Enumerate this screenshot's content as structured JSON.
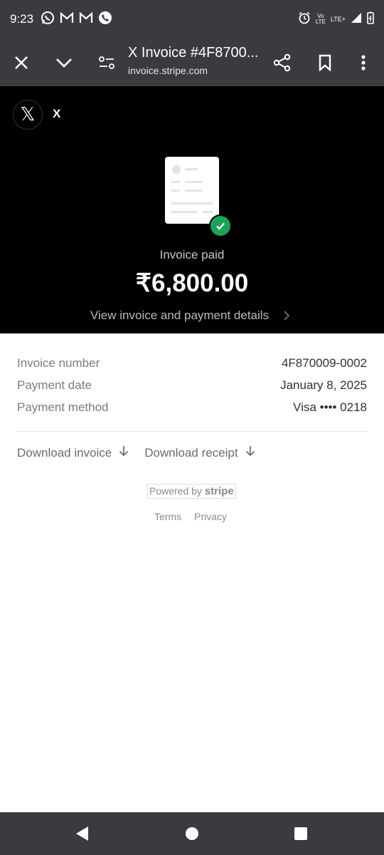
{
  "status_bar": {
    "time": "9:23",
    "icons_left": [
      "whatsapp-icon",
      "gmail-icon",
      "gmail-icon",
      "call-icon"
    ],
    "volte_top": "Vo",
    "volte_bottom": "LTE",
    "lte_label": "LTE+",
    "icons_right": [
      "alarm-icon",
      "signal-icon",
      "battery-icon"
    ]
  },
  "browser": {
    "title": "X Invoice #4F8700...",
    "url": "invoice.stripe.com"
  },
  "merchant": {
    "name": "X",
    "logo_letter": "𝕏"
  },
  "invoice": {
    "status": "Invoice paid",
    "amount": "₹6,800.00",
    "view_details": "View invoice and payment details"
  },
  "details": [
    {
      "label": "Invoice number",
      "value": "4F870009-0002"
    },
    {
      "label": "Payment date",
      "value": "January 8, 2025"
    },
    {
      "label": "Payment method",
      "value": "Visa •••• 0218"
    }
  ],
  "actions": {
    "download_invoice": "Download invoice",
    "download_receipt": "Download receipt"
  },
  "footer": {
    "powered_by": "Powered by",
    "stripe": "stripe",
    "terms": "Terms",
    "privacy": "Privacy"
  },
  "colors": {
    "status_bar_bg": "#3a3b3f",
    "hero_bg": "#000000",
    "success_green": "#1aa35a"
  }
}
